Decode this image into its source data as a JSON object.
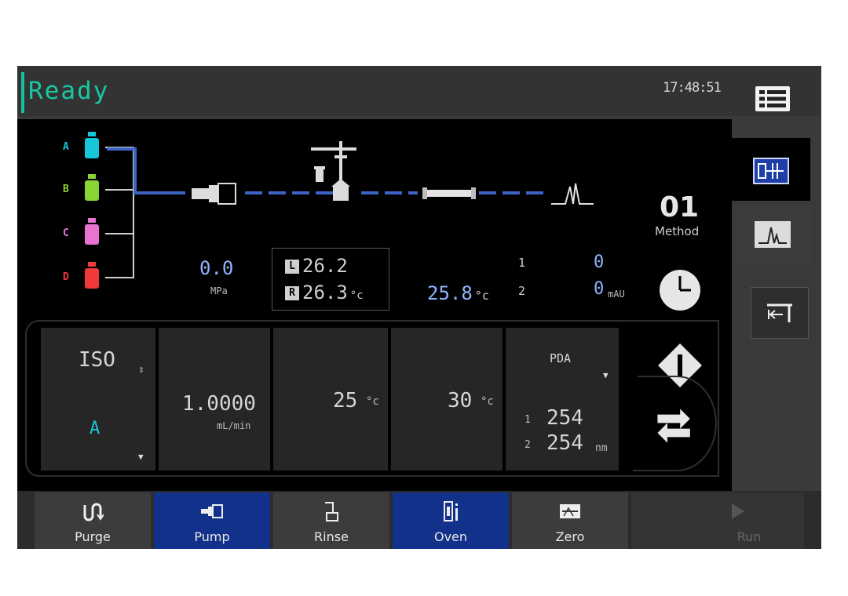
{
  "status": {
    "state": "Ready",
    "time": "17:48:51"
  },
  "flow": {
    "bottles": [
      {
        "letter": "A",
        "color": "#16c6d8"
      },
      {
        "letter": "B",
        "color": "#8ad334"
      },
      {
        "letter": "C",
        "color": "#e873d0"
      },
      {
        "letter": "D",
        "color": "#f03a3a"
      }
    ],
    "pressure": {
      "value": "0.0",
      "unit": "MPa"
    },
    "oven_left": {
      "badge": "L",
      "value": "26.2"
    },
    "oven_right": {
      "badge": "R",
      "value": "26.3",
      "unit": "°c"
    },
    "column_temp": {
      "value": "25.8",
      "unit": "°c"
    },
    "detector": {
      "ch1_label": "1",
      "ch2_label": "2",
      "ch1_value": "0",
      "ch2_value": "0",
      "unit": "mAU"
    }
  },
  "method": {
    "number": "01",
    "label": "Method"
  },
  "tiles": {
    "mode": {
      "label": "ISO",
      "solvent": "A"
    },
    "flow": {
      "value": "1.0000",
      "unit": "mL/min"
    },
    "temp1": {
      "value": "25",
      "unit": "°c"
    },
    "temp2": {
      "value": "30",
      "unit": "°c"
    },
    "detector": {
      "label": "PDA",
      "ch1": "1",
      "ch2": "2",
      "wl1": "254",
      "wl2": "254",
      "unit": "nm"
    }
  },
  "nav": {
    "purge": "Purge",
    "pump": "Pump",
    "rinse": "Rinse",
    "oven": "Oven",
    "zero": "Zero",
    "run": "Run"
  },
  "colors": {
    "accent": "#16c9a4",
    "active_nav": "#12318a",
    "flow_line": "#3f64c8"
  }
}
